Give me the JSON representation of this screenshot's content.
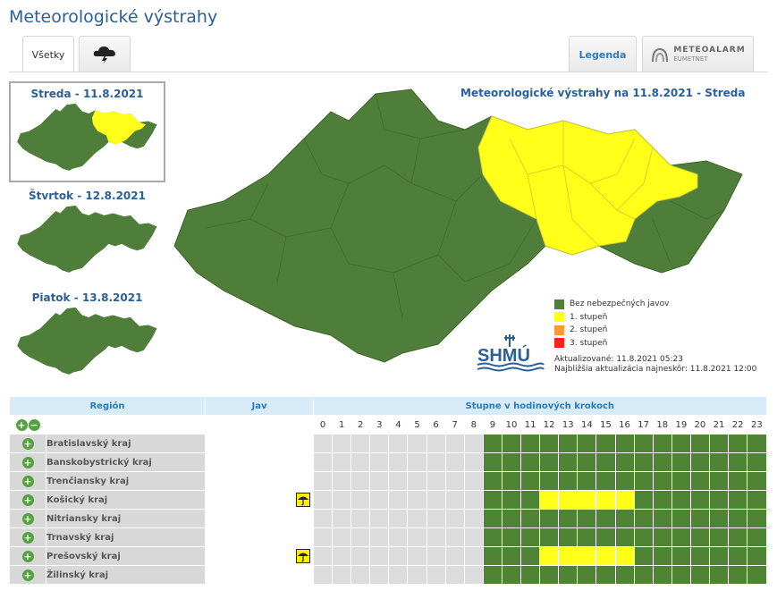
{
  "title": "Meteorologické výstrahy",
  "tabs": {
    "all_label": "Všetky",
    "legend_label": "Legenda",
    "meteoalarm_top": "METEOALARM",
    "meteoalarm_bottom": "EUMETNET"
  },
  "days": [
    {
      "label": "Streda - 11.8.2021"
    },
    {
      "label": "Štvrtok - 12.8.2021"
    },
    {
      "label": "Piatok - 13.8.2021"
    }
  ],
  "map_title": "Meteorologické výstrahy na 11.8.2021 - Streda",
  "legend": [
    {
      "label": "Bez nebezpečných javov",
      "color": "#4f7d3a"
    },
    {
      "label": "1. stupeň",
      "color": "#ffff19"
    },
    {
      "label": "2. stupeň",
      "color": "#ff9933"
    },
    {
      "label": "3. stupeň",
      "color": "#ff2020"
    }
  ],
  "logo_text": "SHMÚ",
  "updated": "Aktualizované: 11.8.2021 05:23",
  "next_update": "Najbližšia aktualizácia najneskôr: 11.8.2021 12:00",
  "table": {
    "col_region": "Región",
    "col_jav": "Jav",
    "col_steps": "Stupne v hodinových krokoch",
    "hours": [
      "0",
      "1",
      "2",
      "3",
      "4",
      "5",
      "6",
      "7",
      "8",
      "9",
      "10",
      "11",
      "12",
      "13",
      "14",
      "15",
      "16",
      "17",
      "18",
      "19",
      "20",
      "21",
      "22",
      "23"
    ],
    "rows": [
      {
        "name": "Bratislavský kraj",
        "phenomenon": "",
        "yellow": []
      },
      {
        "name": "Banskobystrický kraj",
        "phenomenon": "",
        "yellow": []
      },
      {
        "name": "Trenčiansky kraj",
        "phenomenon": "",
        "yellow": []
      },
      {
        "name": "Košický kraj",
        "phenomenon": "thunderstorm-icon",
        "yellow": [
          12,
          13,
          14,
          15,
          16
        ]
      },
      {
        "name": "Nitriansky kraj",
        "phenomenon": "",
        "yellow": []
      },
      {
        "name": "Trnavský kraj",
        "phenomenon": "",
        "yellow": []
      },
      {
        "name": "Prešovský kraj",
        "phenomenon": "thunderstorm-icon",
        "yellow": [
          12,
          13,
          14,
          15,
          16
        ]
      },
      {
        "name": "Žilinský kraj",
        "phenomenon": "",
        "yellow": []
      }
    ],
    "first_active_hour": 9
  }
}
